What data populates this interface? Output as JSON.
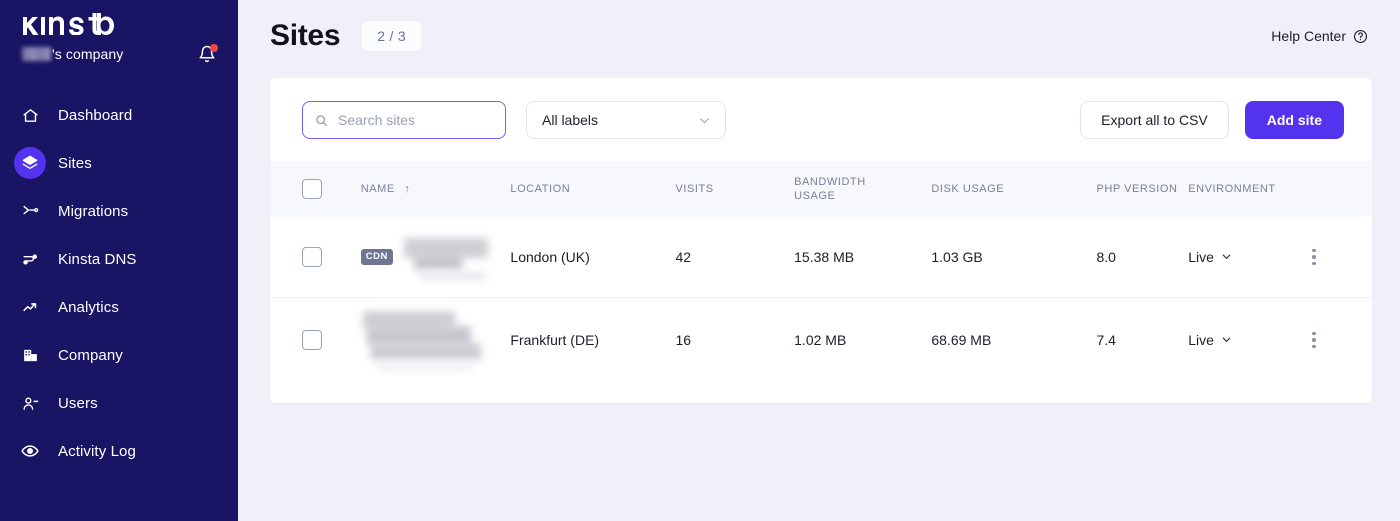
{
  "sidebar": {
    "logo_text": "Kinsta",
    "company_label": "'s company",
    "notification_icon": "bell-icon",
    "items": [
      {
        "label": "Dashboard",
        "icon": "home-icon",
        "active": false
      },
      {
        "label": "Sites",
        "icon": "layers-icon",
        "active": true
      },
      {
        "label": "Migrations",
        "icon": "migration-icon",
        "active": false
      },
      {
        "label": "Kinsta DNS",
        "icon": "dns-icon",
        "active": false
      },
      {
        "label": "Analytics",
        "icon": "analytics-icon",
        "active": false
      },
      {
        "label": "Company",
        "icon": "building-icon",
        "active": false
      },
      {
        "label": "Users",
        "icon": "user-icon",
        "active": false
      },
      {
        "label": "Activity Log",
        "icon": "eye-icon",
        "active": false
      }
    ]
  },
  "header": {
    "title": "Sites",
    "count_badge": "2 / 3",
    "help_center": "Help Center",
    "help_icon": "question-circle-icon"
  },
  "toolbar": {
    "search_placeholder": "Search sites",
    "search_value": "",
    "search_icon": "search-icon",
    "labels_select": "All labels",
    "labels_chevron": "chevron-down-icon",
    "export_label": "Export all to CSV",
    "add_site_label": "Add site"
  },
  "table": {
    "columns": [
      {
        "key": "check",
        "label": ""
      },
      {
        "key": "name",
        "label": "NAME",
        "sorted": "asc",
        "sort_icon": "arrow-up-icon"
      },
      {
        "key": "location",
        "label": "LOCATION"
      },
      {
        "key": "visits",
        "label": "VISITS"
      },
      {
        "key": "bandwidth_line1",
        "label": "BANDWIDTH"
      },
      {
        "key": "bandwidth_line2",
        "label": "USAGE"
      },
      {
        "key": "disk",
        "label": "DISK USAGE"
      },
      {
        "key": "php",
        "label": "PHP VERSION"
      },
      {
        "key": "environment",
        "label": "ENVIRONMENT"
      }
    ],
    "rows": [
      {
        "badge": "CDN",
        "name": "",
        "location": "London (UK)",
        "visits": "42",
        "bandwidth": "15.38 MB",
        "disk": "1.03 GB",
        "php": "8.0",
        "environment": "Live"
      },
      {
        "badge": "",
        "name": "",
        "location": "Frankfurt (DE)",
        "visits": "16",
        "bandwidth": "1.02 MB",
        "disk": "68.69 MB",
        "php": "7.4",
        "environment": "Live"
      }
    ]
  },
  "colors": {
    "sidebar_bg": "#1a1464",
    "accent": "#5333ed",
    "page_bg": "#f0f1f8",
    "card_bg": "#ffffff",
    "header_row_bg": "#f7f8fb",
    "notification_dot": "#f5453d",
    "badge_grey": "#6e7691"
  }
}
